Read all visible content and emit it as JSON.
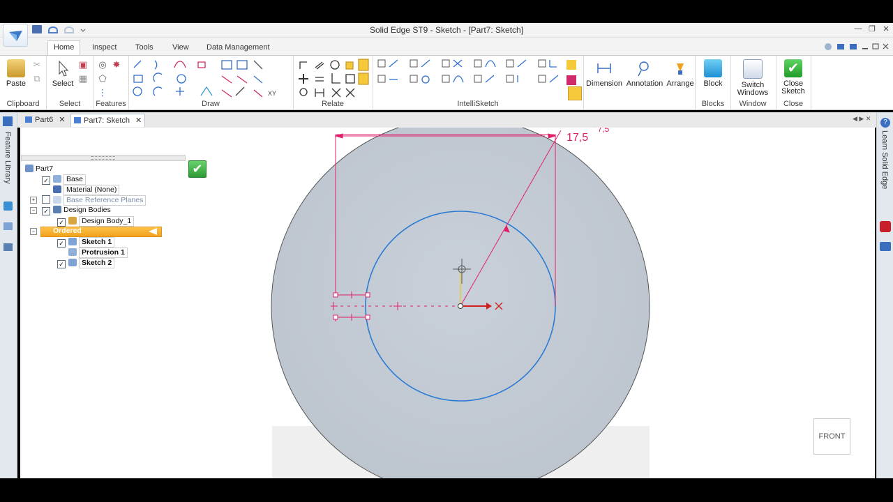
{
  "window": {
    "title": "Solid Edge ST9 - Sketch - [Part7: Sketch]"
  },
  "ribbon_tabs": [
    {
      "label": "Home",
      "active": true
    },
    {
      "label": "Inspect"
    },
    {
      "label": "Tools"
    },
    {
      "label": "View"
    },
    {
      "label": "Data Management"
    }
  ],
  "ribbon": {
    "paste": "Paste",
    "select": "Select",
    "dimension": "Dimension",
    "annotation": "Annotation",
    "arrange": "Arrange",
    "block": "Block",
    "switch_windows_1": "Switch",
    "switch_windows_2": "Windows",
    "close_sketch_1": "Close",
    "close_sketch_2": "Sketch",
    "groups": {
      "clipboard": "Clipboard",
      "select": "Select",
      "features": "Features",
      "draw": "Draw",
      "relate": "Relate",
      "intellisketch": "IntelliSketch",
      "blocks": "Blocks",
      "window": "Window",
      "close": "Close"
    }
  },
  "doc_tabs": [
    {
      "label": "Part6"
    },
    {
      "label": "Part7: Sketch",
      "active": true
    }
  ],
  "rails": {
    "left": "Feature Library",
    "right": "Learn Solid Edge"
  },
  "tree": {
    "root": "Part7",
    "base": "Base",
    "material": "Material (None)",
    "base_ref_planes": "Base Reference Planes",
    "design_bodies": "Design Bodies",
    "design_body_1": "Design Body_1",
    "ordered": "Ordered",
    "sketch1": "Sketch 1",
    "protrusion1": "Protrusion 1",
    "sketch2": "Sketch 2"
  },
  "sketch": {
    "dimension_label": "17,5",
    "dimension_label_partial": "' 7,5"
  },
  "view_cube": {
    "label": "FRONT"
  },
  "colors": {
    "sketch_magenta": "#e0206a",
    "circle_blue": "#2a7bd4",
    "solid_face": "#c4ccd6",
    "highlight_orange": "#f5a623",
    "accept_green": "#34a83a"
  }
}
